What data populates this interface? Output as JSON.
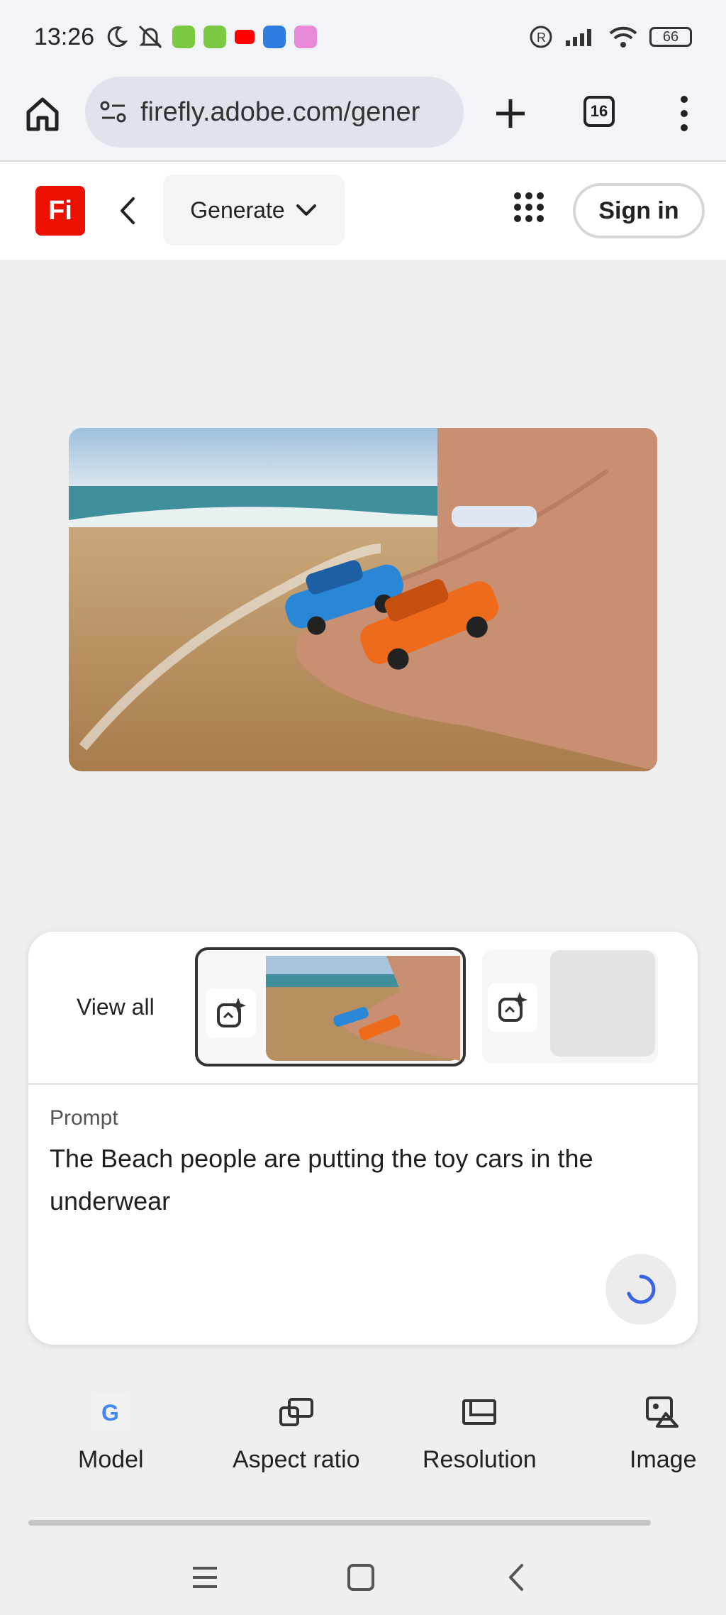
{
  "status_bar": {
    "time": "13:26",
    "battery": "66"
  },
  "browser": {
    "url": "firefly.adobe.com/gener",
    "tab_count": "16"
  },
  "header": {
    "logo": "Fi",
    "mode_dropdown": "Generate",
    "sign_in": "Sign in"
  },
  "results": {
    "view_all": "View all"
  },
  "prompt": {
    "label": "Prompt",
    "text": "The Beach people are putting the toy cars in the underwear"
  },
  "toolbar": {
    "items": [
      {
        "label": "Model",
        "icon": "google-g-icon"
      },
      {
        "label": "Aspect ratio",
        "icon": "aspect-ratio-icon"
      },
      {
        "label": "Resolution",
        "icon": "resolution-icon"
      },
      {
        "label": "Image",
        "icon": "image-icon"
      }
    ]
  },
  "colors": {
    "brand": "#eb1000",
    "spinner": "#3b63e6"
  }
}
